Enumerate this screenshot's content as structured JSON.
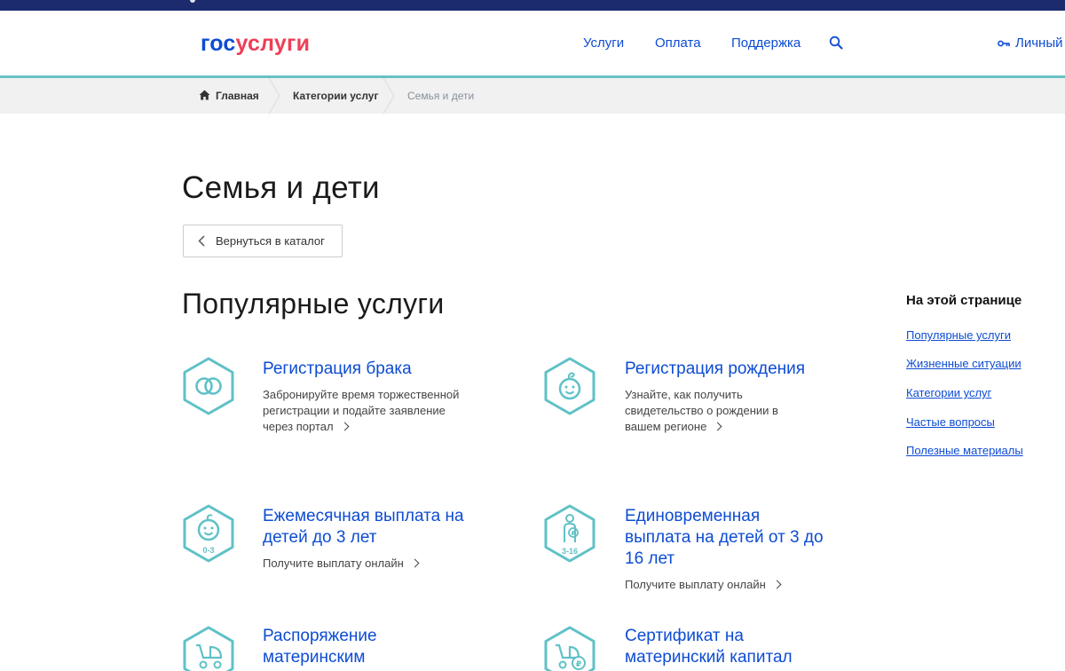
{
  "header": {
    "logo_gos": "гос",
    "logo_uslugi": "услуги",
    "nav": [
      "Услуги",
      "Оплата",
      "Поддержка"
    ],
    "personal_label": "Личный"
  },
  "breadcrumb": {
    "items": [
      "Главная",
      "Категории услуг",
      "Семья и дети"
    ]
  },
  "page": {
    "title": "Семья и дети",
    "back_button": "Вернуться в каталог",
    "section_title": "Популярные услуги"
  },
  "services": [
    {
      "icon": "rings-icon",
      "title": "Регистрация брака",
      "desc": "Забронируйте время торжественной регистрации и подайте заявление через портал"
    },
    {
      "icon": "baby-face-icon",
      "title": "Регистрация рождения",
      "desc": "Узнайте, как получить свидетельство о рождении в вашем регионе"
    },
    {
      "icon": "baby-0-3-icon",
      "icon_label": "0-3",
      "title": "Ежемесячная выплата на детей до 3 лет",
      "desc": "Получите выплату онлайн"
    },
    {
      "icon": "child-3-16-icon",
      "icon_label": "3-16",
      "title": "Единовременная выплата на детей от 3 до 16 лет",
      "desc": "Получите выплату онлайн"
    },
    {
      "icon": "stroller-icon",
      "title": "Распоряжение материнским",
      "desc": ""
    },
    {
      "icon": "stroller-ruble-icon",
      "title": "Сертификат на материнский капитал",
      "desc": ""
    }
  ],
  "sidebar": {
    "title": "На этой странице",
    "links": [
      "Популярные услуги",
      "Жизненные ситуации",
      "Категории услуг",
      "Частые вопросы",
      "Полезные материалы"
    ]
  },
  "colors": {
    "brand_blue": "#0d4cd3",
    "brand_red": "#ee3f58",
    "accent_teal": "#68c1c4",
    "topbar_navy": "#1b2b6e"
  }
}
